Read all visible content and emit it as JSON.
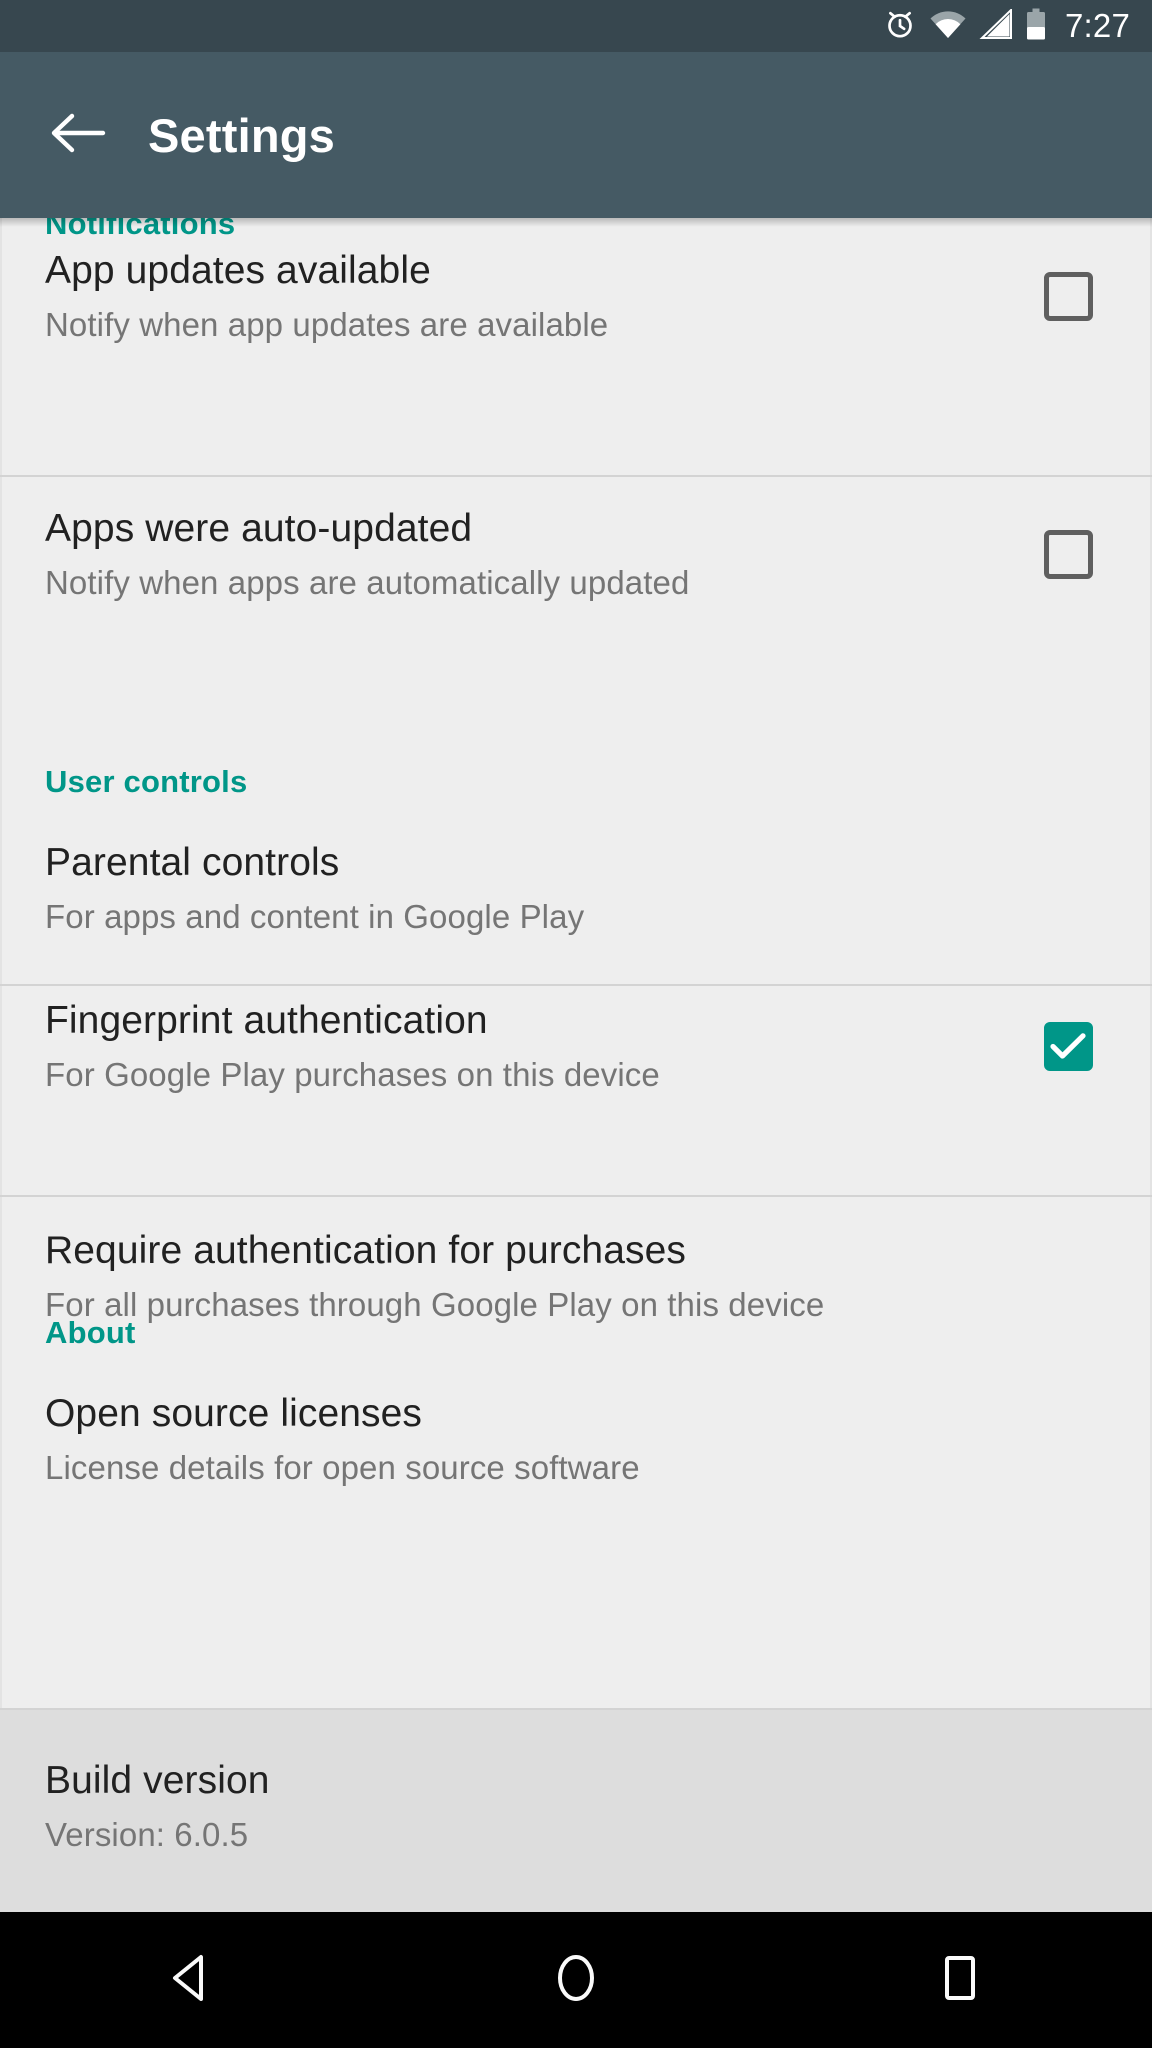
{
  "status_bar": {
    "time": "7:27",
    "icons": [
      "alarm-icon",
      "wifi-icon",
      "signal-icon",
      "battery-icon"
    ]
  },
  "app_bar": {
    "back_label": "back-arrow-icon",
    "title": "Settings"
  },
  "sections": [
    {
      "header": "Notifications",
      "rows": [
        {
          "title": "App updates available",
          "subtitle": "Notify when app updates are available",
          "control": "checkbox",
          "checked": false
        },
        {
          "title": "Apps were auto-updated",
          "subtitle": "Notify when apps are automatically updated",
          "control": "checkbox",
          "checked": false
        }
      ]
    },
    {
      "header": "User controls",
      "rows": [
        {
          "title": "Parental controls",
          "subtitle": "For apps and content in Google Play",
          "control": "none",
          "checked": false
        },
        {
          "title": "Fingerprint authentication",
          "subtitle": "For Google Play purchases on this device",
          "control": "checkbox",
          "checked": true
        },
        {
          "title": "Require authentication for purchases",
          "subtitle": "For all purchases through Google Play on this device",
          "control": "none",
          "checked": false
        }
      ]
    },
    {
      "header": "About",
      "rows": [
        {
          "title": "Open source licenses",
          "subtitle": "License details for open source software",
          "control": "none",
          "checked": false
        },
        {
          "title": "Build version",
          "subtitle": "Version: 6.0.5",
          "control": "none",
          "checked": false,
          "pressed": true
        }
      ]
    }
  ],
  "nav_bar": {
    "back": "back-triangle-icon",
    "home": "home-circle-icon",
    "recents": "recents-square-icon"
  },
  "colors": {
    "status_bar": "#37474F",
    "app_bar": "#455A64",
    "accent_teal": "#009688",
    "content_bg": "#EEEEEE",
    "pressed_bg": "#DDDDDD",
    "title_text": "#212121",
    "subtitle_text": "#757575",
    "divider": "#D3D3D3",
    "nav_bar": "#000000"
  }
}
